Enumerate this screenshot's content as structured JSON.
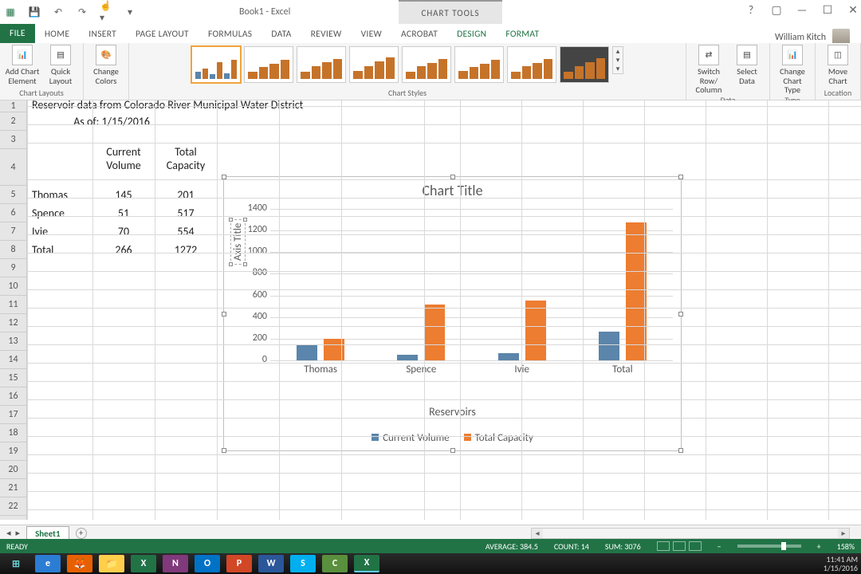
{
  "window": {
    "title": "Book1 - Excel",
    "chart_tools": "CHART TOOLS"
  },
  "user": "William Kitch",
  "tabs": [
    "FILE",
    "HOME",
    "INSERT",
    "PAGE LAYOUT",
    "FORMULAS",
    "DATA",
    "REVIEW",
    "VIEW",
    "ACROBAT",
    "DESIGN",
    "FORMAT"
  ],
  "ribbon": {
    "btn_add": "Add Chart Element",
    "btn_quick": "Quick Layout",
    "btn_colors": "Change Colors",
    "grp_layouts": "Chart Layouts",
    "grp_styles": "Chart Styles",
    "btn_switch": "Switch Row/ Column",
    "btn_select": "Select Data",
    "grp_data": "Data",
    "btn_type": "Change Chart Type",
    "grp_type": "Type",
    "btn_move": "Move Chart",
    "grp_loc": "Location"
  },
  "cells": {
    "a1": "Reservoir data from Colorado River Municipal Water District",
    "a2": "As of: 1/15/2016",
    "b4": "Current Volume",
    "c4": "Total Capacity",
    "a5": "Thomas",
    "b5": "145",
    "c5": "201",
    "a6": "Spence",
    "b6": "51",
    "c6": "517",
    "a7": "Ivie",
    "b7": "70",
    "c7": "554",
    "a8": "Total",
    "b8": "266",
    "c8": "1272"
  },
  "chart_data": {
    "type": "bar",
    "title": "Chart Title",
    "categories": [
      "Thomas",
      "Spence",
      "Ivie",
      "Total"
    ],
    "series": [
      {
        "name": "Current Volume",
        "values": [
          145,
          51,
          70,
          266
        ],
        "color": "#5b85aa"
      },
      {
        "name": "Total Capacity",
        "values": [
          201,
          517,
          554,
          1272
        ],
        "color": "#ed7d31"
      }
    ],
    "xlabel": "Reservoirs",
    "ylabel": "Axis Title",
    "ylim": [
      0,
      1400
    ],
    "ygrid_step": 200
  },
  "sheet_tab": "Sheet1",
  "status": {
    "ready": "READY",
    "avg_label": "AVERAGE:",
    "avg": "384.5",
    "count_label": "COUNT:",
    "count": "14",
    "sum_label": "SUM:",
    "sum": "3076",
    "zoom": "158%"
  },
  "tray": {
    "time": "11:41 AM",
    "date": "1/15/2016"
  }
}
